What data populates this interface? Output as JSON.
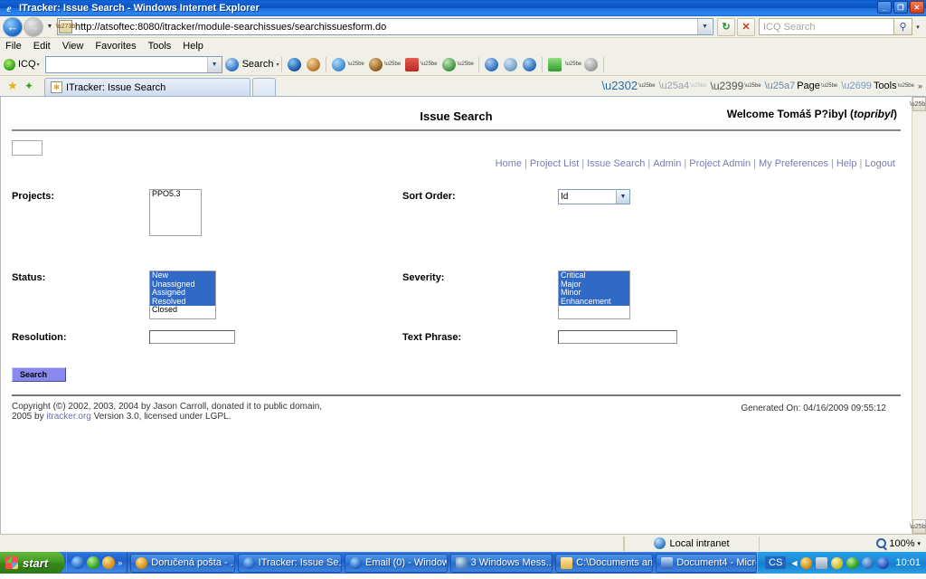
{
  "window": {
    "title": "ITracker: Issue Search - Windows Internet Explorer",
    "minimize_label": "_",
    "restore_label": "❐",
    "close_label": "✕"
  },
  "navbar": {
    "back_label": "←",
    "forward_label": "→",
    "history_caret": "▼",
    "address_value": "http://atsoftec:8080/itracker/module-searchissues/searchissuesform.do",
    "address_caret": "▼",
    "refresh_label": "↻",
    "stop_label": "✕",
    "icq_search_placeholder": "ICQ Search",
    "icq_search_go": "⚲",
    "icq_search_caret": "▾"
  },
  "menubar": {
    "items": [
      "File",
      "Edit",
      "View",
      "Favorites",
      "Tools",
      "Help"
    ]
  },
  "icqbar": {
    "brand": "ICQ",
    "brand_caret": "▾",
    "input_value": "",
    "input_caret": "▼",
    "search_label": "Search",
    "search_caret": "▾",
    "icons": [
      {
        "name": "icq-globe-icon",
        "color": "#2d6fc0",
        "caret": false
      },
      {
        "name": "icq-person-icon",
        "color": "#c98a3a",
        "caret": false
      },
      {
        "name": "icq-chat-icon",
        "color": "#4f9ad8",
        "caret": true
      },
      {
        "name": "icq-contacts-icon",
        "color": "#b07a32",
        "caret": true
      },
      {
        "name": "icq-mail-icon",
        "color": "#cc3a33",
        "caret": true
      },
      {
        "name": "icq-games-icon",
        "color": "#5bb05b",
        "caret": true
      },
      {
        "name": "icq-adduser-icon",
        "color": "#3a7ec8",
        "caret": false
      },
      {
        "name": "icq-finduser-icon",
        "color": "#6fa8d8",
        "caret": false
      },
      {
        "name": "icq-userinfo-icon",
        "color": "#3a7ec8",
        "caret": false
      },
      {
        "name": "icq-notes-icon",
        "color": "#4aa84a",
        "caret": false
      },
      {
        "name": "icq-extra-icon",
        "color": "#8a8a8a",
        "caret": true
      }
    ]
  },
  "tabbar": {
    "favorites_star": "★",
    "add_favorite": "✦",
    "tab_title": "ITracker: Issue Search",
    "tab_icon_glyph": "✻",
    "new_tab_label": "",
    "commands": [
      {
        "name": "home-button",
        "label": "",
        "glyph": "⌂",
        "caret": true
      },
      {
        "name": "feeds-button",
        "label": "",
        "glyph": "▤",
        "caret": false
      },
      {
        "name": "print-button",
        "label": "",
        "glyph": "⎙",
        "caret": true
      },
      {
        "name": "page-menu-button",
        "label": "Page",
        "glyph": "▧",
        "caret": true
      },
      {
        "name": "tools-menu-button",
        "label": "Tools",
        "glyph": "⚙",
        "caret": true
      }
    ],
    "overflow": "»"
  },
  "page": {
    "title": "Issue Search",
    "welcome_prefix": "Welcome Tomáš P?ibyl (",
    "welcome_user": "topribyl",
    "welcome_suffix": ")",
    "nav_links": [
      "Home",
      "Project List",
      "Issue Search",
      "Admin",
      "Project Admin",
      "My Preferences",
      "Help",
      "Logout"
    ],
    "nav_separator": "|",
    "form": {
      "projects_label": "Projects:",
      "projects_options": [
        {
          "label": "PPO5.3",
          "selected": false
        }
      ],
      "sort_order_label": "Sort Order:",
      "sort_order_value": "Id",
      "sort_order_caret": "▼",
      "status_label": "Status:",
      "status_options": [
        {
          "label": "New",
          "selected": true
        },
        {
          "label": "Unassigned",
          "selected": true
        },
        {
          "label": "Assigned",
          "selected": true
        },
        {
          "label": "Resolved",
          "selected": true
        },
        {
          "label": "Closed",
          "selected": false
        }
      ],
      "severity_label": "Severity:",
      "severity_options": [
        {
          "label": "Critical",
          "selected": true
        },
        {
          "label": "Major",
          "selected": true
        },
        {
          "label": "Minor",
          "selected": true
        },
        {
          "label": "Enhancement",
          "selected": true
        }
      ],
      "resolution_label": "Resolution:",
      "resolution_value": "",
      "text_phrase_label": "Text Phrase:",
      "text_phrase_value": "",
      "search_button_label": "Search"
    },
    "footer": {
      "copyright_line1": "Copyright (©) 2002, 2003, 2004 by Jason Carroll, donated it to public domain,",
      "copyright_line2_pre": "2005 by ",
      "copyright_link": "itracker.org",
      "copyright_line2_post": " Version 3.0, licensed under LGPL.",
      "generated_on": "Generated On: 04/16/2009 09:55:12"
    }
  },
  "statusbar": {
    "zone_label": "Local intranet",
    "zoom_label": "100%",
    "zoom_caret": "▾"
  },
  "taskbar": {
    "start_label": "start",
    "quicklaunch": [
      {
        "name": "ie-quicklaunch-icon",
        "color": "#2c74c8"
      },
      {
        "name": "show-desktop-icon",
        "color": "#3fb54a"
      },
      {
        "name": "icq-quicklaunch-icon",
        "color": "#e8a01e"
      }
    ],
    "quicklaunch_overflow": "»",
    "items": [
      {
        "name": "taskbar-item-dorucena-posta",
        "label": "Doručená pošta - ...",
        "color": "#e8a01e",
        "caret": false
      },
      {
        "name": "taskbar-item-itracker",
        "label": "ITracker: Issue Se...",
        "color": "#2c74c8",
        "caret": false
      },
      {
        "name": "taskbar-item-email",
        "label": "Email (0) - Window...",
        "color": "#2c74c8",
        "caret": false
      },
      {
        "name": "taskbar-item-windows-messenger",
        "label": "3 Windows Mess...",
        "color": "#4a8ad0",
        "caret": true
      },
      {
        "name": "taskbar-item-documents",
        "label": "C:\\Documents and...",
        "color": "#e3c05a",
        "caret": false
      },
      {
        "name": "taskbar-item-document4",
        "label": "Document4 - Micro...",
        "color": "#3a6fc0",
        "caret": false
      }
    ],
    "tray": {
      "language": "CS",
      "show_hidden": "◀",
      "icons": [
        {
          "name": "tray-icq-icon",
          "color": "#e8a01e"
        },
        {
          "name": "tray-network-icon",
          "color": "#9fb4c8"
        },
        {
          "name": "tray-security-icon",
          "color": "#d8d040"
        },
        {
          "name": "tray-wifi-icon",
          "color": "#3fb54a"
        },
        {
          "name": "tray-update-icon",
          "color": "#3a7ec8"
        },
        {
          "name": "tray-bluetooth-icon",
          "color": "#2a5fc0"
        }
      ],
      "clock": "10:01"
    }
  }
}
